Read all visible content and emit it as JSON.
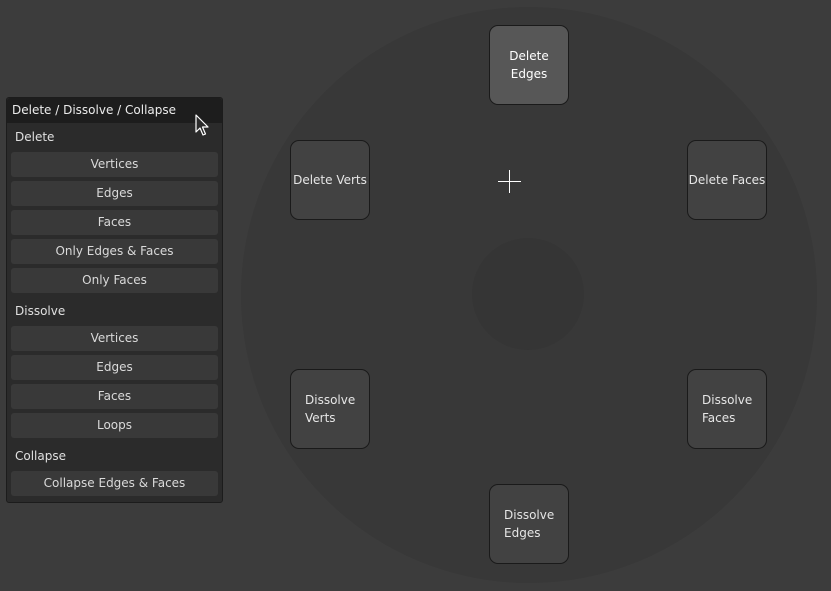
{
  "colors": {
    "background": "#3c3c3c",
    "pie_disc": "#383838",
    "pie_button": "#424242",
    "pie_button_active": "#575757",
    "menu_background": "#2b2b2b",
    "menu_title_background": "#1d1d1d",
    "menu_item": "#393939"
  },
  "pie_menu": {
    "buttons": [
      {
        "name": "delete-edges",
        "label": "Delete Edges",
        "active": true
      },
      {
        "name": "delete-verts",
        "label": "Delete Verts"
      },
      {
        "name": "delete-faces",
        "label": "Delete Faces"
      },
      {
        "name": "dissolve-verts",
        "label": "Dissolve\nVerts"
      },
      {
        "name": "dissolve-faces",
        "label": "Dissolve\nFaces"
      },
      {
        "name": "dissolve-edges",
        "label": "Dissolve\nEdges"
      }
    ]
  },
  "menu": {
    "title": "Delete / Dissolve / Collapse",
    "sections": [
      {
        "label": "Delete",
        "items": [
          "Vertices",
          "Edges",
          "Faces",
          "Only Edges & Faces",
          "Only Faces"
        ]
      },
      {
        "label": "Dissolve",
        "items": [
          "Vertices",
          "Edges",
          "Faces",
          "Loops"
        ]
      },
      {
        "label": "Collapse",
        "items": [
          "Collapse Edges & Faces"
        ]
      }
    ]
  },
  "icons": {
    "crosshair": "crosshair-icon",
    "cursor": "mouse-pointer-icon"
  }
}
